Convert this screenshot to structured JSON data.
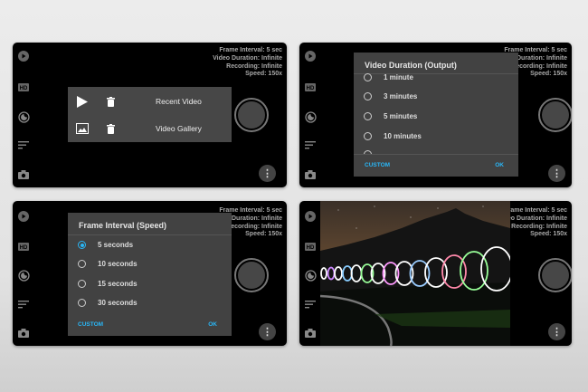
{
  "status": {
    "frame_interval": "Frame Interval: 5 sec",
    "video_duration": "Video Duration: Infinite",
    "recording": "Recording: Infinite",
    "speed": "Speed: 150x"
  },
  "side_icons": [
    "play-icon",
    "hd-icon",
    "exposure-icon",
    "sort-icon",
    "camera-icon"
  ],
  "hd_label": "HD",
  "more_label": "⋮",
  "video_menu": {
    "items": [
      {
        "label": "Recent Video",
        "icon": "play-icon"
      },
      {
        "label": "Video Gallery",
        "icon": "gallery-icon"
      }
    ]
  },
  "duration_dialog": {
    "title": "Video Duration (Output)",
    "options": [
      "1 minute",
      "3 minutes",
      "5 minutes",
      "10 minutes"
    ],
    "custom": "CUSTOM",
    "ok": "OK"
  },
  "interval_dialog": {
    "title": "Frame Interval (Speed)",
    "options": [
      "5 seconds",
      "10 seconds",
      "15 seconds",
      "30 seconds"
    ],
    "selected": 0,
    "custom": "CUSTOM",
    "ok": "OK"
  },
  "colors": {
    "accent": "#29b6f6",
    "dialog": "#424242"
  }
}
